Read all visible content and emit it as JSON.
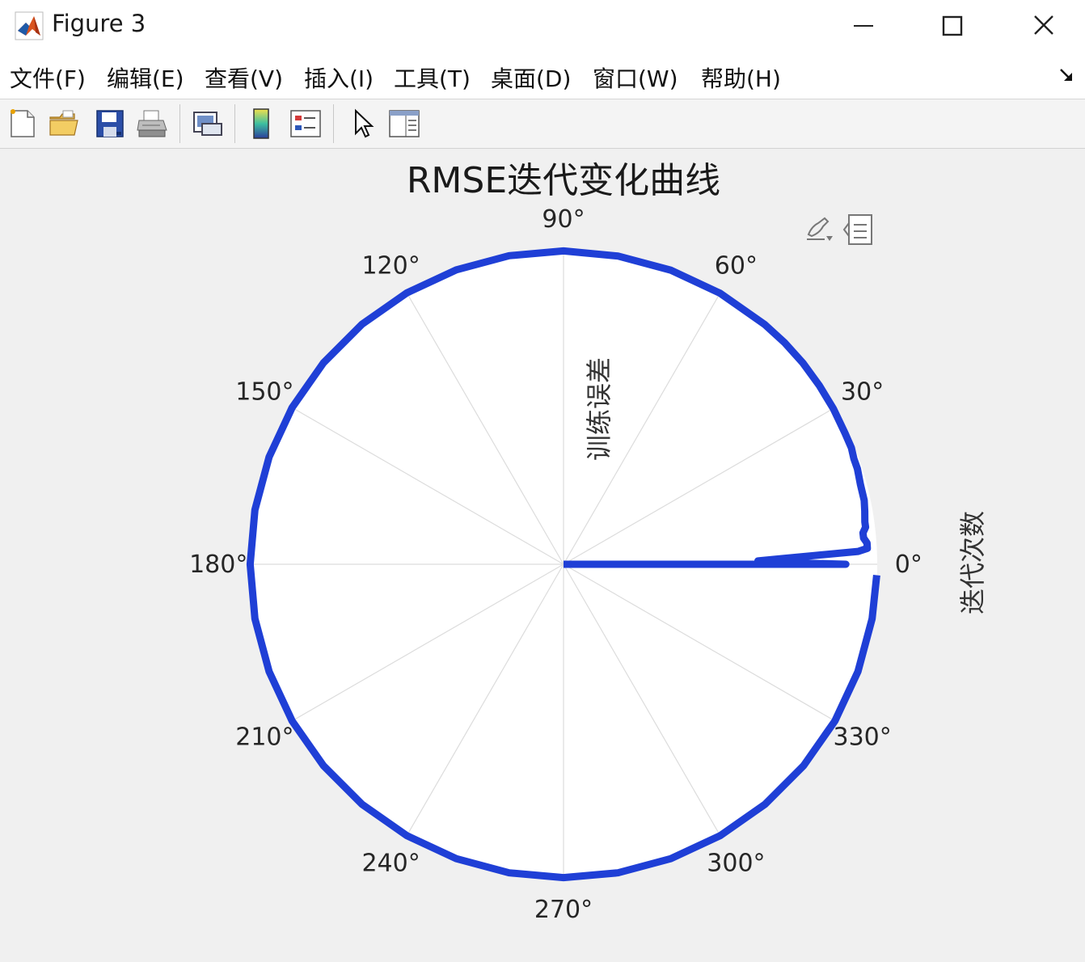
{
  "window": {
    "title": "Figure 3",
    "controls": {
      "minimize": "minimize",
      "maximize": "maximize",
      "close": "close"
    }
  },
  "menu": {
    "items": [
      {
        "label": "文件(F)"
      },
      {
        "label": "编辑(E)"
      },
      {
        "label": "查看(V)"
      },
      {
        "label": "插入(I)"
      },
      {
        "label": "工具(T)"
      },
      {
        "label": "桌面(D)"
      },
      {
        "label": "窗口(W)"
      },
      {
        "label": "帮助(H)"
      }
    ]
  },
  "toolbar": {
    "icons": [
      "new-figure-icon",
      "open-folder-icon",
      "save-icon",
      "print-icon",
      "link-plot-icon",
      "colorbar-icon",
      "legend-icon",
      "pointer-icon",
      "property-inspector-icon"
    ]
  },
  "axes_toolbar": {
    "icons": [
      "brush-edit-icon",
      "data-tips-icon"
    ]
  },
  "colors": {
    "series": "#1f3fd6",
    "grid": "#dcdcdc",
    "axes_bg": "#ffffff",
    "figure_bg": "#f0f0f0"
  },
  "chart_data": {
    "type": "polar-line",
    "title": "RMSE迭代变化曲线",
    "theta_label": "迭代次数",
    "r_label": "训练误差",
    "theta_ticks": [
      "0°",
      "30°",
      "60°",
      "90°",
      "120°",
      "150°",
      "180°",
      "210°",
      "240°",
      "270°",
      "300°",
      "330°"
    ],
    "theta_tick_values": [
      0,
      30,
      60,
      90,
      120,
      150,
      180,
      210,
      240,
      270,
      300,
      330
    ],
    "theta_direction": "counterclockwise",
    "grid": true,
    "r_tick_labels_shown": false,
    "rlim": [
      0,
      1
    ],
    "series": [
      {
        "color": "#1f3fd6",
        "theta_deg": [
          0,
          0.5,
          1,
          1.5,
          2,
          2.5,
          3,
          4,
          5,
          6,
          7,
          8,
          10,
          12,
          15,
          18,
          20,
          22,
          25,
          30,
          35,
          40,
          45,
          50,
          60,
          70,
          80,
          90,
          100,
          110,
          120,
          130,
          140,
          150,
          160,
          170,
          180,
          190,
          200,
          210,
          220,
          230,
          240,
          250,
          260,
          270,
          280,
          290,
          300,
          310,
          320,
          330,
          340,
          350,
          358
        ],
        "r": [
          0.9,
          0.68,
          0.62,
          0.7,
          0.8,
          0.94,
          0.97,
          0.97,
          0.96,
          0.96,
          0.97,
          0.97,
          0.975,
          0.98,
          0.98,
          0.985,
          0.985,
          0.99,
          0.99,
          0.993,
          0.995,
          0.997,
          0.998,
          0.998,
          0.998,
          0.998,
          0.998,
          0.999,
          0.999,
          0.999,
          0.999,
          0.999,
          0.999,
          0.999,
          0.999,
          0.999,
          0.999,
          0.999,
          0.999,
          0.999,
          0.999,
          0.999,
          0.999,
          0.999,
          0.999,
          0.999,
          0.999,
          0.999,
          0.999,
          0.999,
          0.999,
          0.999,
          0.999,
          0.999,
          0.999
        ]
      }
    ]
  }
}
